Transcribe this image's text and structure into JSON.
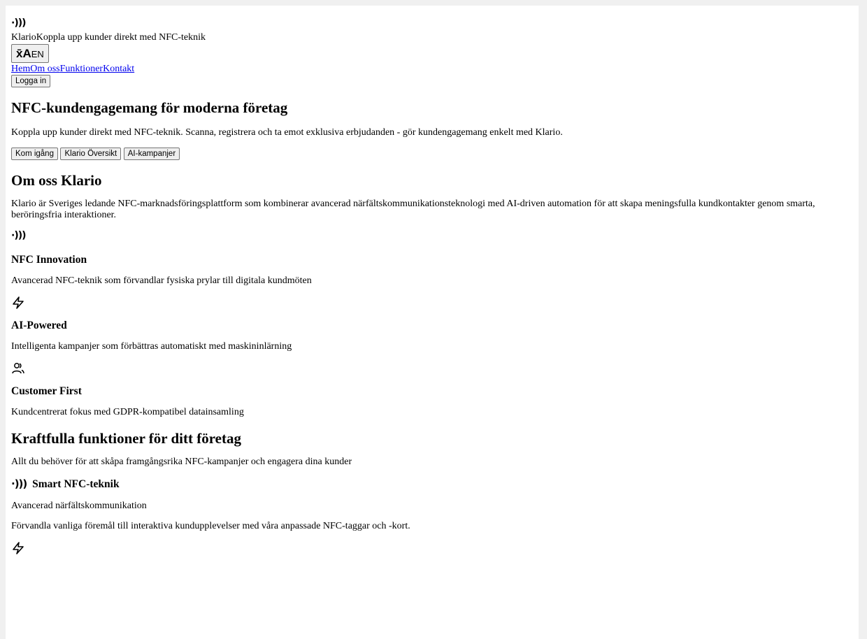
{
  "header": {
    "brand_icon": "nfc-wave-icon",
    "brand_name": "Klario",
    "brand_tagline": "Koppla upp kunder direkt med NFC-teknik",
    "lang_button": {
      "glyph": "x̄A",
      "code": "EN"
    },
    "nav": [
      "Hem",
      "Om oss",
      "Funktioner",
      "Kontakt"
    ],
    "login": "Logga in"
  },
  "hero": {
    "title": "NFC-kundengagemang för moderna företag",
    "text": "Koppla upp kunder direkt med NFC-teknik. Scanna, registrera och ta emot exklusiva erbjudanden - gör kundengagemang enkelt med Klario.",
    "buttons": [
      "Kom igång",
      "Klario Översikt",
      "AI-kampanjer"
    ]
  },
  "about": {
    "title": "Om oss Klario",
    "text": "Klario är Sveriges ledande NFC-marknadsföringsplattform som kombinerar avancerad närfältskommunikationsteknologi med AI-driven automation för att skapa meningsfulla kundkontakter genom smarta, beröringsfria interaktioner.",
    "values": [
      {
        "icon": "nfc-wave-icon",
        "title": "NFC Innovation",
        "text": "Avancerad NFC-teknik som förvandlar fysiska prylar till digitala kundmöten"
      },
      {
        "icon": "lightning-icon",
        "title": "AI-Powered",
        "text": "Intelligenta kampanjer som förbättras automatiskt med maskininlärning"
      },
      {
        "icon": "users-icon",
        "title": "Customer First",
        "text": "Kundcentrerat fokus med GDPR-kompatibel datainsamling"
      }
    ]
  },
  "features": {
    "title": "Kraftfulla funktioner för ditt företag",
    "text": "Allt du behöver för att skåpa framgångsrika NFC-kampanjer och engagera dina kunder",
    "items": [
      {
        "icon": "nfc-wave-icon",
        "title": "Smart NFC-teknik",
        "subtitle": "Avancerad närfältskommunikation",
        "text": "Förvandla vanliga föremål till interaktiva kundupplevelser med våra anpassade NFC-taggar och -kort."
      }
    ]
  }
}
